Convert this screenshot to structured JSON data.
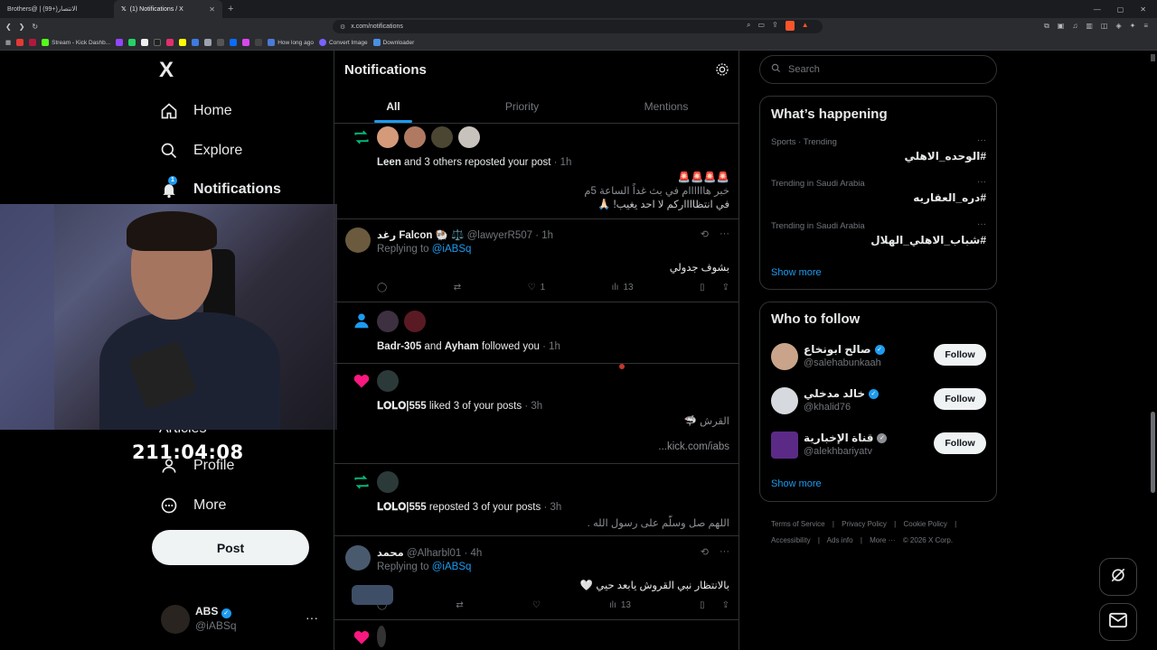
{
  "browser": {
    "tabs": [
      {
        "label": "Brothers@ | الانتصار(+99)"
      },
      {
        "label": "(1) Notifications / X",
        "close": "✕"
      }
    ],
    "new_tab": "+",
    "url": "x.com/notifications",
    "bookmarks": [
      {
        "label": "Stream - Kick Dashb...",
        "color": "#53fc18"
      },
      {
        "label": "How long ago",
        "color": "#4a7bd6"
      },
      {
        "label": "Convert Image",
        "color": "#7b61ff"
      },
      {
        "label": "Downloader",
        "color": "#4a90e2"
      }
    ],
    "brave_badge": "1"
  },
  "nav": {
    "logo": "X",
    "items": [
      {
        "label": "Home",
        "icon": "home-icon"
      },
      {
        "label": "Explore",
        "icon": "search-icon"
      },
      {
        "label": "Notifications",
        "icon": "bell-icon",
        "badge": "1"
      }
    ],
    "articles_label": "Articles",
    "profile_label": "Profile",
    "more_label": "More",
    "post_button": "Post",
    "account": {
      "name": "ABS",
      "handle": "@iABSq",
      "more": "···"
    }
  },
  "stream_timer": "211:04:08",
  "notifications": {
    "title": "Notifications",
    "tabs": [
      {
        "label": "All"
      },
      {
        "label": "Priority"
      },
      {
        "label": "Mentions"
      }
    ],
    "items": [
      {
        "type": "repost",
        "who": "Leen",
        "text": "and 3 others reposted your post",
        "time": "· 1h",
        "emoji_line": "🚨🚨🚨🚨",
        "body_line1": "خبر هاااااام في بث غداً الساعة 5م",
        "body_line2": "في انتظااااركم لا احد يغيب! 🙏🏻"
      },
      {
        "type": "reply",
        "name": "رغد Falcon 🐏 ⚖️",
        "handle": "@lawyerR507",
        "time": "· 1h",
        "replying_prefix": "Replying to",
        "replying_to": "@iABSq",
        "body": "بشوف جدولي",
        "likes": "1",
        "views": "13"
      },
      {
        "type": "follow",
        "who1": "Badr-305",
        "and": "and",
        "who2": "Ayham",
        "text": "followed you",
        "time": "· 1h"
      },
      {
        "type": "like",
        "who": "𝐋𝐎𝐋𝐎|555",
        "text": "liked 3 of your posts",
        "time": "· 3h",
        "line1": "القرش 🦈",
        "line2": "kick.com/iabs..."
      },
      {
        "type": "repost",
        "who": "𝐋𝐎𝐋𝐎|555",
        "text": "reposted 3 of your posts",
        "time": "· 3h",
        "line1": "اللهم صل وسلّم على رسول الله ."
      },
      {
        "type": "reply",
        "name": "محمد",
        "handle": "@Alharbl01",
        "time": "· 4h",
        "replying_prefix": "Replying to",
        "replying_to": "@iABSq",
        "body": "بالانتظار نبي القروش يابعد حيي 🤍",
        "views": "13"
      }
    ]
  },
  "search": {
    "placeholder": "Search"
  },
  "happening": {
    "title": "What’s happening",
    "trends": [
      {
        "meta": "Sports · Trending",
        "tag": "#الوحده_الاهلي"
      },
      {
        "meta": "Trending in Saudi Arabia",
        "tag": "#دره_العقاريه"
      },
      {
        "meta": "Trending in Saudi Arabia",
        "tag": "#شباب_الاهلي_الهلال"
      }
    ],
    "show_more": "Show more"
  },
  "who_to_follow": {
    "title": "Who to follow",
    "users": [
      {
        "name": "صالح ابونخاع",
        "handle": "@salehabunkaah",
        "button": "Follow",
        "avatar_color": "#c9a48a"
      },
      {
        "name": "خالد مدخلي",
        "handle": "@khalid76",
        "button": "Follow",
        "avatar_color": "#d6d9de"
      },
      {
        "name": "قناة الإخبارية",
        "handle": "@alekhbariyatv",
        "button": "Follow",
        "avatar_color": "#5b2a86"
      }
    ],
    "show_more": "Show more"
  },
  "footer": {
    "links": [
      "Terms of Service",
      "|",
      "Privacy Policy",
      "|",
      "Cookie Policy",
      "|"
    ],
    "links2": [
      "Accessibility",
      "|",
      "Ads info",
      "|",
      "More ···",
      "© 2026 X Corp."
    ]
  },
  "colors": {
    "accent": "#1d9bf0",
    "repost": "#00ba7c",
    "like": "#f91880"
  }
}
